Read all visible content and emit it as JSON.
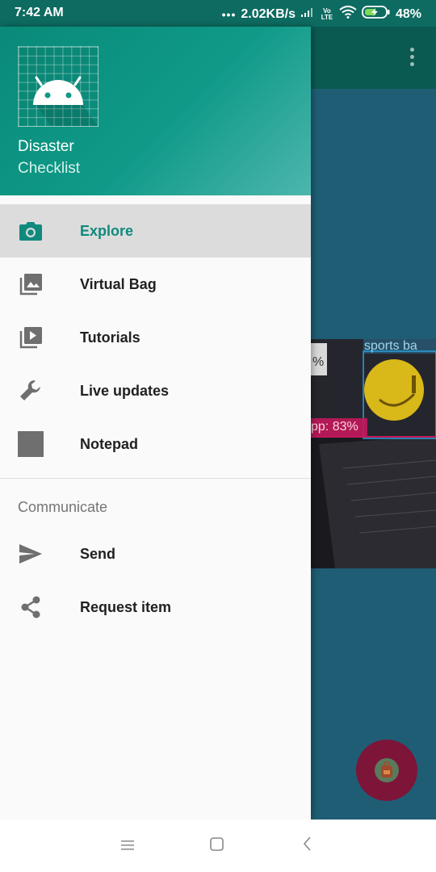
{
  "status_bar": {
    "time": "7:42 AM",
    "network_speed": "2.02KB/s",
    "volte": "Vo LTE",
    "battery": "48%"
  },
  "background_app": {
    "image_labels": [
      "sports ba",
      "%",
      "pp: 83%"
    ]
  },
  "drawer": {
    "header": {
      "title": "Disaster",
      "subtitle": "Checklist",
      "logo_icon": "android-icon"
    },
    "items": [
      {
        "label": "Explore",
        "icon": "camera-icon",
        "active": true
      },
      {
        "label": "Virtual Bag",
        "icon": "gallery-icon",
        "active": false
      },
      {
        "label": "Tutorials",
        "icon": "video-library-icon",
        "active": false
      },
      {
        "label": "Live updates",
        "icon": "wrench-icon",
        "active": false
      },
      {
        "label": "Notepad",
        "icon": "square-icon",
        "active": false
      }
    ],
    "section": {
      "title": "Communicate",
      "items": [
        {
          "label": "Send",
          "icon": "send-icon"
        },
        {
          "label": "Request item",
          "icon": "share-icon"
        }
      ]
    }
  },
  "colors": {
    "primary": "#0f8a7c",
    "header_start": "#0a8a78",
    "header_end": "#4db6ac",
    "active_item_bg": "#dcdcdc",
    "fab": "#7c1538"
  },
  "nav_bar": {
    "buttons": [
      "menu-icon",
      "home-icon",
      "back-icon"
    ]
  }
}
